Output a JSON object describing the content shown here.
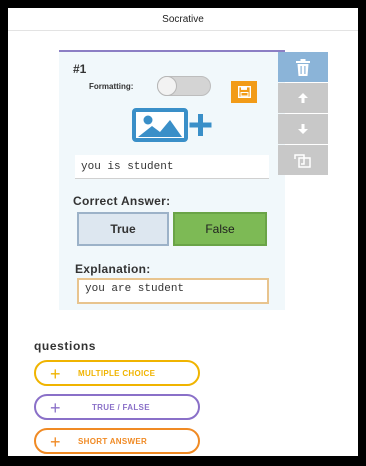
{
  "window": {
    "title": "Socrative"
  },
  "question": {
    "number": "#1",
    "formatting_label": "Formatting:",
    "question_text": "you is student",
    "correct_answer_label": "Correct Answer:",
    "answers": {
      "true_label": "True",
      "false_label": "False",
      "selected": "False"
    },
    "explanation_label": "Explanation:",
    "explanation_text": "you are student"
  },
  "side_actions": {
    "icons": [
      "trash-icon",
      "arrow-up-icon",
      "arrow-down-icon",
      "copy-icon"
    ]
  },
  "add_questions": {
    "title": "questions",
    "buttons": [
      {
        "label": "MULTIPLE CHOICE",
        "color": "#f0b400"
      },
      {
        "label": "TRUE / FALSE",
        "color": "#8a70c8"
      },
      {
        "label": "SHORT ANSWER",
        "color": "#f08a24"
      }
    ]
  },
  "colors": {
    "accent_purple": "#8c7fc4",
    "save_orange": "#f29b18",
    "false_green": "#7dba55",
    "image_blue": "#3a8fc8",
    "side_blue": "#8bb4d8",
    "side_grey": "#c8c8c8"
  }
}
